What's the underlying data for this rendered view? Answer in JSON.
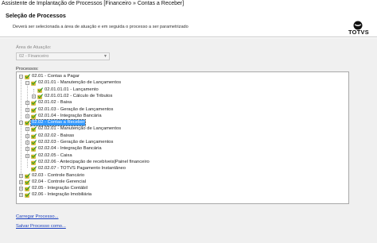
{
  "window": {
    "title": "Assistente de Implantação de Processos [Financeiro » Contas a Receber]"
  },
  "header": {
    "title": "Seleção de Processos",
    "description": "Deverá ser selecionada a área de atuação e em seguida o processo a ser parametrizado",
    "logo_text": "TOTVS"
  },
  "area": {
    "label": "Área de Atuação:",
    "value": "02 - Financeiro"
  },
  "processes": {
    "label": "Processos:",
    "items": [
      {
        "label": "02.01 - Contas a Pagar",
        "expander": "−"
      },
      {
        "label": "02.01.01 - Manutenção de Lançamentos",
        "expander": "−"
      },
      {
        "label": "02.01.01.01 - Lançamento",
        "expander": ""
      },
      {
        "label": "02.01.01.02 - Cálculo de Tributos",
        "expander": "+"
      },
      {
        "label": "02.01.02 - Baixa",
        "expander": "+"
      },
      {
        "label": "02.01.03 - Geração de Lançamentos",
        "expander": "+"
      },
      {
        "label": "02.01.04 - Integração Bancária",
        "expander": "+"
      },
      {
        "label": "02.02 - Contas a Receber",
        "expander": "−"
      },
      {
        "label": "02.02.01 - Manutenção de Lançamentos",
        "expander": "+"
      },
      {
        "label": "02.02.02 - Baixas",
        "expander": "+"
      },
      {
        "label": "02.02.03 - Geração de Lançamentos",
        "expander": "+"
      },
      {
        "label": "02.02.04 - Integração Bancária",
        "expander": "+"
      },
      {
        "label": "02.02.05 - Caixa",
        "expander": "+"
      },
      {
        "label": "02.02.06 - Antecipação de recebíveis|Painel financeiro",
        "expander": ""
      },
      {
        "label": "02.02.07 - TOTVS Pagamento Instantâneo",
        "expander": ""
      },
      {
        "label": "02.03 - Controle Bancário",
        "expander": "+"
      },
      {
        "label": "02.04 - Controle Gerencial",
        "expander": "+"
      },
      {
        "label": "02.05 - Integração Contábil",
        "expander": "+"
      },
      {
        "label": "02.06 - Integração Imobiliária",
        "expander": "+"
      }
    ]
  },
  "links": {
    "load": "Carregar Processo...",
    "save": "Salvar Processo como..."
  },
  "colors": {
    "check": "#2e9b2e",
    "box": "#e8c21a",
    "selection": "#3399ff",
    "link": "#1a3fbf"
  }
}
